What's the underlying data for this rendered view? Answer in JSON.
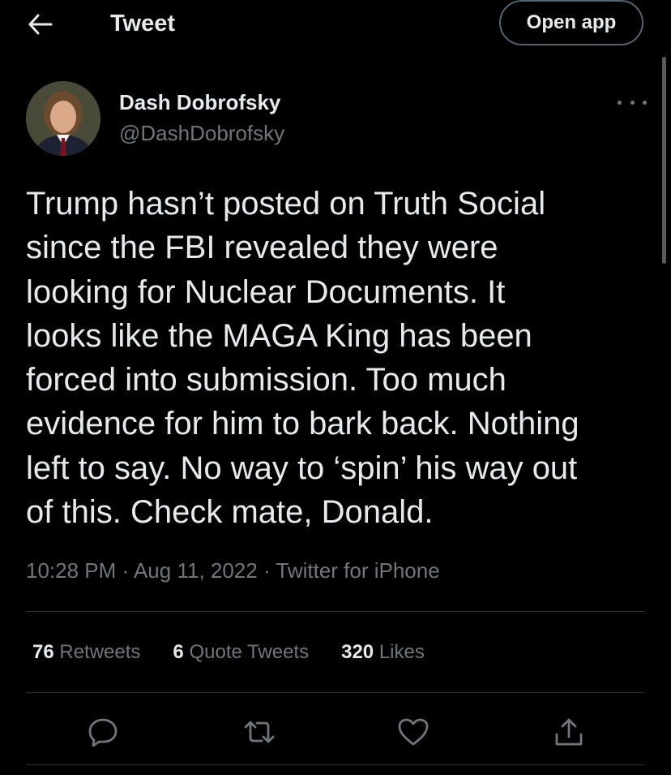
{
  "header": {
    "title": "Tweet",
    "back_icon": "arrow-left-icon",
    "open_app_label": "Open app"
  },
  "author": {
    "name": "Dash Dobrofsky",
    "handle": "@DashDobrofsky",
    "avatar_icon": "profile-photo",
    "more_icon": "more-horizontal-icon"
  },
  "tweet": {
    "text": "Trump hasn’t posted on Truth Social\nsince the FBI revealed they were\nlooking for Nuclear Documents. It\nlooks like the MAGA King has been\nforced into submission. Too much\nevidence for him to bark back. Nothing\nleft to say. No way to ‘spin’ his way out\nof this. Check mate, Donald.",
    "time": "10:28 PM",
    "date": "Aug 11, 2022",
    "source": "Twitter for iPhone",
    "separator": " · "
  },
  "stats": {
    "retweets_count": "76",
    "retweets_label": "Retweets",
    "quotes_count": "6",
    "quotes_label": "Quote Tweets",
    "likes_count": "320",
    "likes_label": "Likes"
  },
  "actions": {
    "reply_icon": "reply-icon",
    "retweet_icon": "retweet-icon",
    "like_icon": "heart-icon",
    "share_icon": "share-icon"
  },
  "colors": {
    "background": "#000000",
    "primary_text": "#e7e9ea",
    "secondary_text": "#71767b",
    "divider": "#2f3336",
    "button_border": "#536471"
  }
}
